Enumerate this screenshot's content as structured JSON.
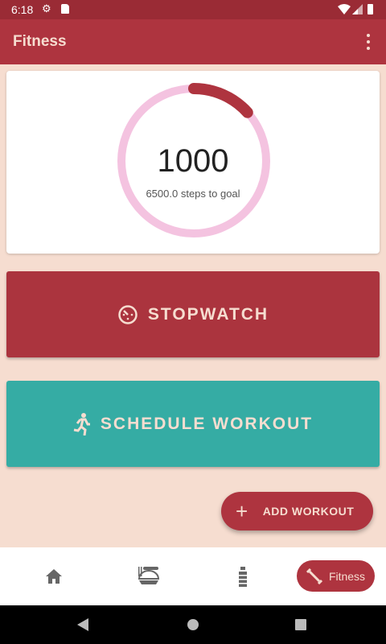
{
  "status_bar": {
    "time": "6:18",
    "icons": [
      "gear-icon",
      "sd-card-icon",
      "wifi-icon",
      "signal-icon",
      "battery-icon"
    ]
  },
  "app_bar": {
    "title": "Fitness",
    "menu_icon": "more-vert-icon"
  },
  "steps_card": {
    "steps": "1000",
    "goal_text": "6500.0 steps to goal",
    "progress_fraction": 0.133,
    "ring_color": "#f4c3e0",
    "progress_color": "#ae343f"
  },
  "buttons": {
    "stopwatch": "STOPWATCH",
    "schedule": "SCHEDULE WORKOUT"
  },
  "fab": {
    "label": "ADD WORKOUT"
  },
  "bottom_nav": {
    "items": [
      {
        "icon": "home-icon"
      },
      {
        "icon": "food-icon"
      },
      {
        "icon": "water-bottle-icon"
      },
      {
        "icon": "dumbbell-icon",
        "label": "Fitness",
        "selected": true
      }
    ]
  },
  "colors": {
    "primary": "#ae343f",
    "teal": "#35aca4",
    "background": "#f6ddd0"
  }
}
